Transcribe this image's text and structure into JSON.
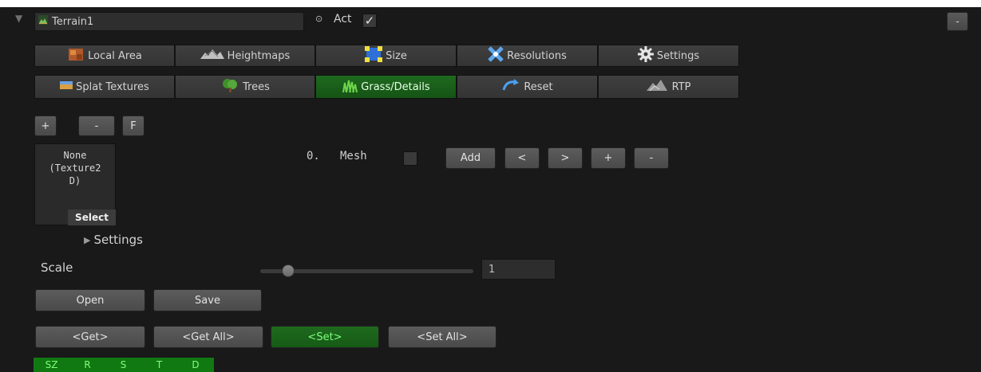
{
  "header": {
    "object_name": "Terrain1",
    "act_label": "Act",
    "act_checked": true,
    "corner_button": "-"
  },
  "tabs_row1": [
    {
      "label": "Local Area",
      "icon": "local-area-icon"
    },
    {
      "label": "Heightmaps",
      "icon": "heightmaps-icon"
    },
    {
      "label": "Size",
      "icon": "size-icon"
    },
    {
      "label": "Resolutions",
      "icon": "resolutions-icon"
    },
    {
      "label": "Settings",
      "icon": "settings-gear-icon"
    }
  ],
  "tabs_row2": [
    {
      "label": "Splat Textures",
      "icon": "splat-textures-icon",
      "active": false
    },
    {
      "label": "Trees",
      "icon": "trees-icon",
      "active": false
    },
    {
      "label": "Grass/Details",
      "icon": "grass-icon",
      "active": true
    },
    {
      "label": "Reset",
      "icon": "reset-icon",
      "active": false
    },
    {
      "label": "RTP",
      "icon": "rtp-icon",
      "active": false
    }
  ],
  "detail_buttons": {
    "add": "+",
    "remove": "-",
    "f": "F"
  },
  "texture": {
    "label": "None\n(Texture2\nD)",
    "select": "Select"
  },
  "detail_row": {
    "index": "0.",
    "mesh_label": "Mesh",
    "mesh_checked": false,
    "add": "Add",
    "prev": "<",
    "next": ">",
    "plus": "+",
    "minus": "-"
  },
  "settings_foldout": "Settings",
  "scale": {
    "label": "Scale",
    "value": "1",
    "slider_fraction": 0.13
  },
  "file_buttons": {
    "open": "Open",
    "save": "Save"
  },
  "get_set": {
    "get": "<Get>",
    "get_all": "<Get All>",
    "set": "<Set>",
    "set_all": "<Set All>",
    "set_active": true
  },
  "bottom_strip": [
    "SZ",
    "R",
    "S",
    "T",
    "D"
  ],
  "colors": {
    "panel_bg": "#191919",
    "active_green": "#155315",
    "bright_green": "#7dff7d"
  }
}
